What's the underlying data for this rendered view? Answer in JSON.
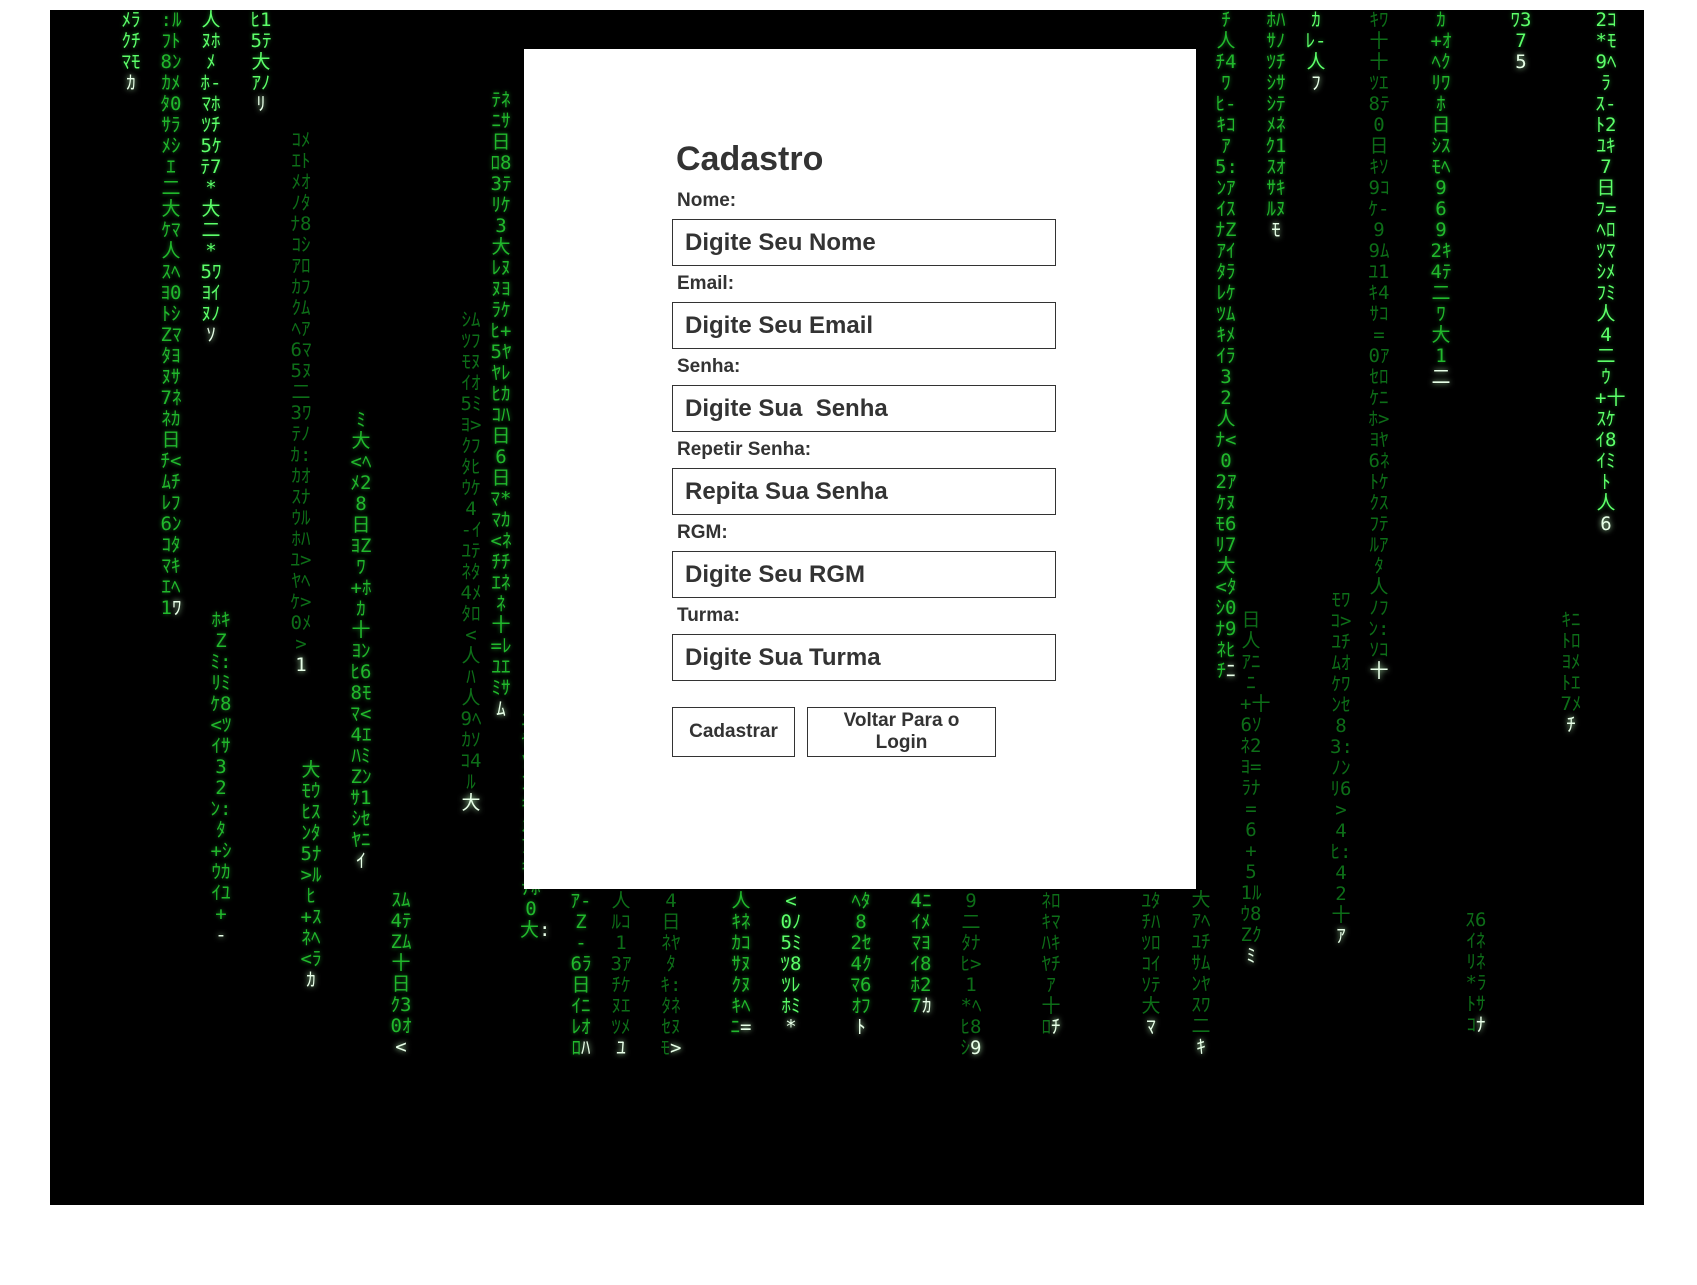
{
  "form": {
    "title": "Cadastro",
    "fields": [
      {
        "label": "Nome:",
        "placeholder": "Digite Seu Nome"
      },
      {
        "label": "Email:",
        "placeholder": "Digite Seu Email"
      },
      {
        "label": "Senha:",
        "placeholder": "Digite Sua  Senha"
      },
      {
        "label": "Repetir Senha:",
        "placeholder": "Repita Sua Senha"
      },
      {
        "label": "RGM:",
        "placeholder": "Digite Seu RGM"
      },
      {
        "label": "Turma:",
        "placeholder": "Digite Sua Turma"
      }
    ],
    "buttons": {
      "submit_label": "Cadastrar",
      "back_label": "Voltar Para o Login"
    }
  },
  "background": {
    "style": "matrix-digital-rain",
    "rain_color": "#21b82c",
    "bg_color": "#000000"
  },
  "colors": {
    "text": "#333333",
    "card": "#ffffff"
  }
}
